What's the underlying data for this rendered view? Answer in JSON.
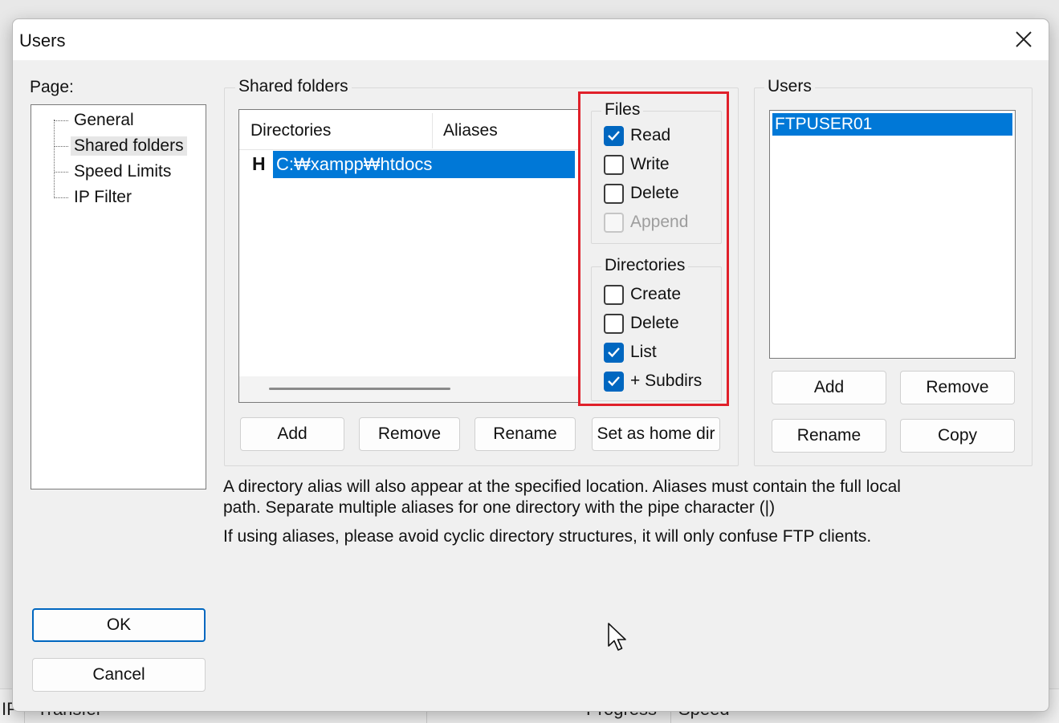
{
  "background": {
    "col_ip": "IP",
    "col_transfer": "Transfer",
    "col_progress": "Progress",
    "col_speed": "Speed"
  },
  "dialog": {
    "title": "Users",
    "page_label": "Page:",
    "pages": [
      {
        "label": "General"
      },
      {
        "label": "Shared folders",
        "selected": true
      },
      {
        "label": "Speed Limits"
      },
      {
        "label": "IP Filter"
      }
    ],
    "shared_folders": {
      "group_title": "Shared folders",
      "columns": [
        "Directories",
        "Aliases"
      ],
      "rows": [
        {
          "flag": "H",
          "path": "C:₩xampp₩htdocs"
        }
      ],
      "buttons": {
        "add": "Add",
        "remove": "Remove",
        "rename": "Rename",
        "set_home": "Set as home dir"
      }
    },
    "files": {
      "group_title": "Files",
      "read": {
        "label": "Read",
        "checked": true
      },
      "write": {
        "label": "Write",
        "checked": false
      },
      "delete": {
        "label": "Delete",
        "checked": false
      },
      "append": {
        "label": "Append",
        "checked": false,
        "disabled": true
      }
    },
    "directories": {
      "group_title": "Directories",
      "create": {
        "label": "Create",
        "checked": false
      },
      "delete": {
        "label": "Delete",
        "checked": false
      },
      "list": {
        "label": "List",
        "checked": true
      },
      "subdirs": {
        "label": "+ Subdirs",
        "checked": true
      }
    },
    "users": {
      "group_title": "Users",
      "items": [
        "FTPUSER01"
      ],
      "buttons": {
        "add": "Add",
        "remove": "Remove",
        "rename": "Rename",
        "copy": "Copy"
      }
    },
    "notes": {
      "line1": "A directory alias will also appear at the specified location. Aliases must contain the full local",
      "line2": "path. Separate multiple aliases for one directory with the pipe character (|)",
      "line3": "If using aliases, please avoid cyclic directory structures, it will only confuse FTP clients."
    },
    "ok_label": "OK",
    "cancel_label": "Cancel"
  },
  "colors": {
    "accent": "#0067c0",
    "selection": "#0078d7",
    "highlight": "#e0202a"
  }
}
